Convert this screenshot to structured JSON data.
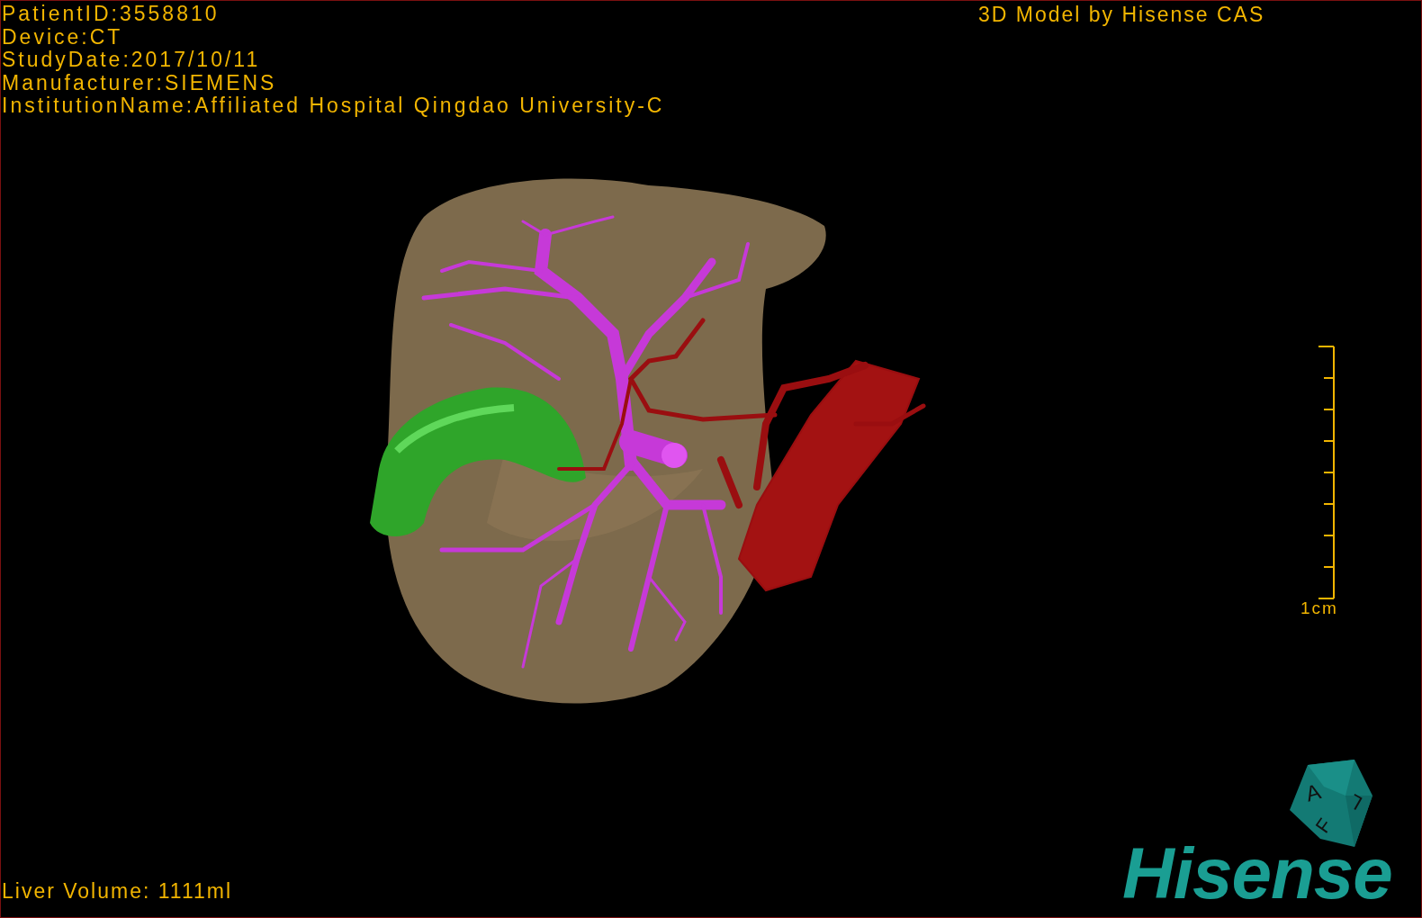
{
  "viewer": {
    "info_lines": [
      "PatientID:3558810",
      "Device:CT",
      "StudyDate:2017/10/11",
      "Manufacturer:SIEMENS",
      "InstitutionName:Affiliated Hospital Qingdao University-C"
    ],
    "title": "3D Model by Hisense CAS",
    "scale_bar": {
      "label": "1cm"
    },
    "orientation_cube": {
      "labels": [
        "A",
        "L",
        "F"
      ]
    },
    "liver_volume": "Liver Volume: 1111ml",
    "logo": "Hisense"
  }
}
